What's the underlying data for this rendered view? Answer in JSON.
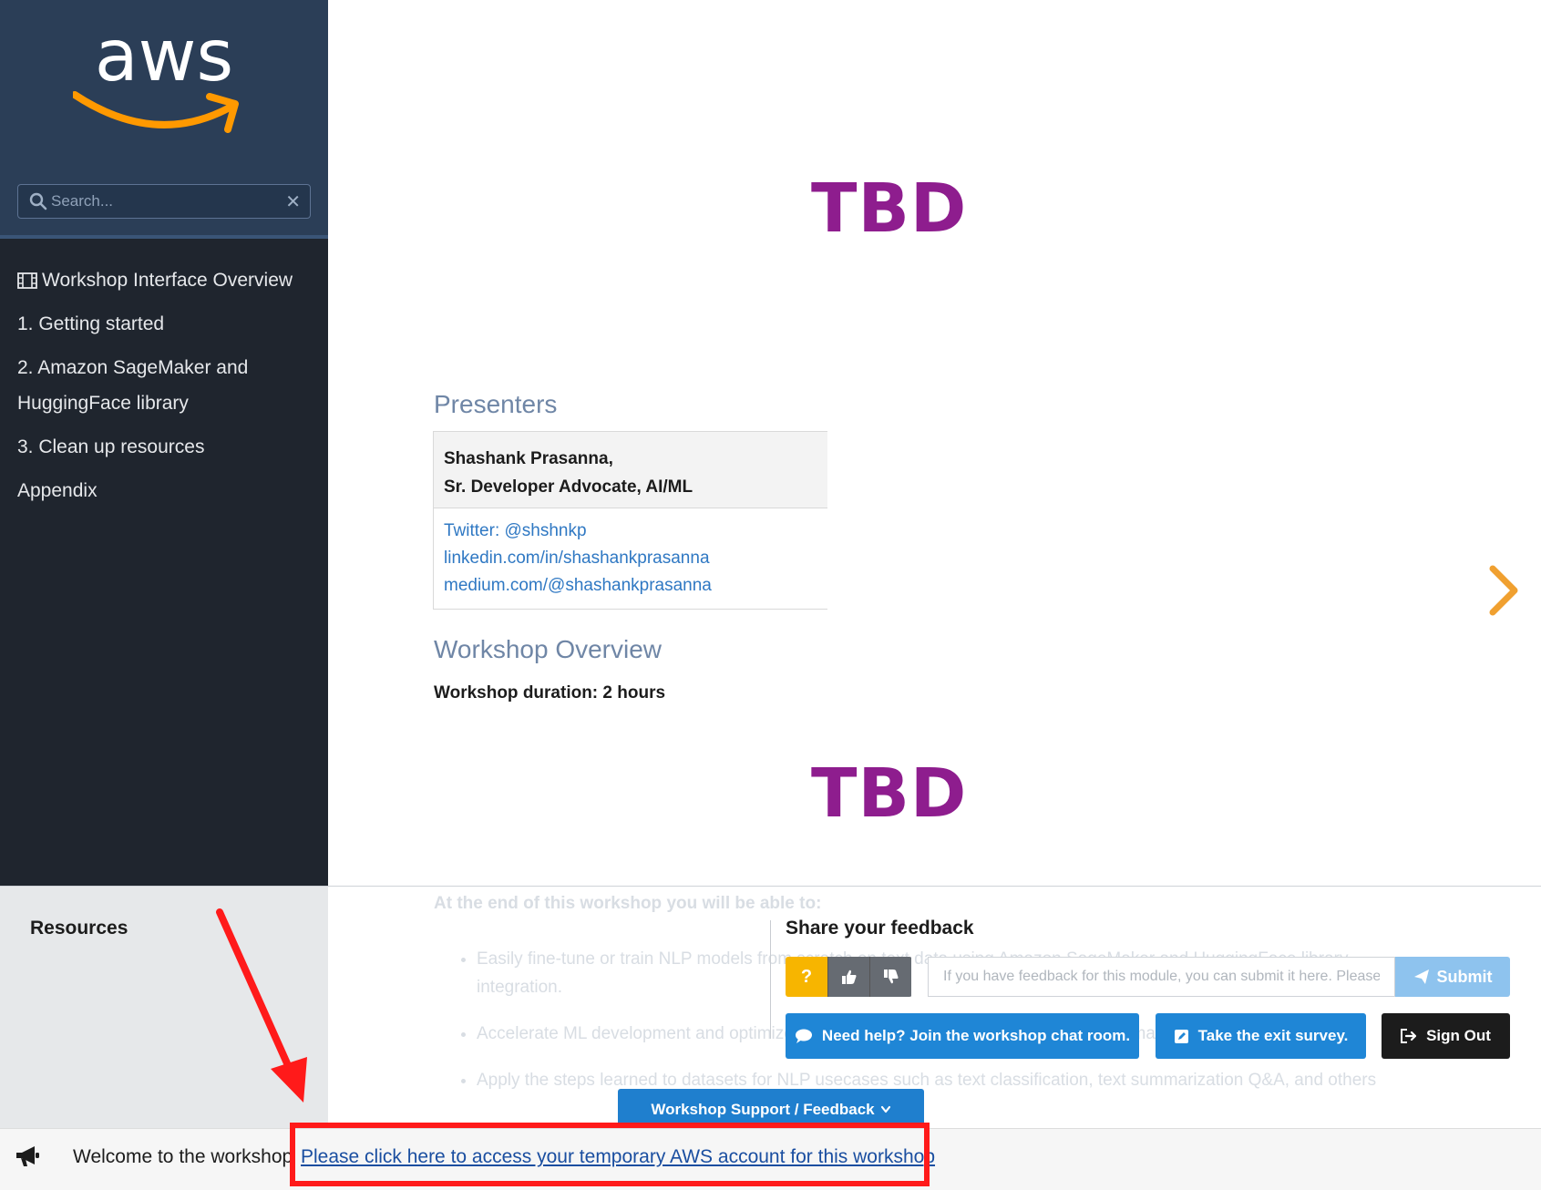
{
  "sidebar": {
    "search": {
      "placeholder": "Search...",
      "clear": "✕"
    },
    "items": [
      {
        "label": "Workshop Interface Overview",
        "icon": "film-icon"
      },
      {
        "label": "1. Getting started"
      },
      {
        "label": "2. Amazon SageMaker and HuggingFace library"
      },
      {
        "label": "3. Clean up resources"
      },
      {
        "label": "Appendix"
      }
    ]
  },
  "logo": {
    "text": "aws",
    "brand_color": "#ff9900"
  },
  "main": {
    "placeholder_image_text": "TBD",
    "presenters_title": "Presenters",
    "presenter": {
      "name_line": "Shashank Prasanna,",
      "title_line": "Sr. Developer Advocate, AI/ML",
      "links": [
        "Twitter: @shshnkp",
        "linkedin.com/in/shashankprasanna",
        "medium.com/@shashankprasanna"
      ]
    },
    "overview_title": "Workshop Overview",
    "duration": "Workshop duration: 2 hours",
    "faded": {
      "heading": "At the end of this workshop you will be able to:",
      "bullets": [
        "Easily fine-tune or train NLP models from scratch on text data using Amazon SageMaker and HuggingFace library integration.",
        "Accelerate ML development and optimize cost using managed training instances and managed spot training",
        "Apply the steps learned to datasets for NLP usecases such as text classification, text summarization Q&A, and others"
      ]
    }
  },
  "bottom": {
    "resources_title": "Resources",
    "feedback_title": "Share your feedback",
    "rating": {
      "question": "?"
    },
    "feedback_placeholder": "If you have feedback for this module, you can submit it here. Please",
    "submit_label": "Submit",
    "chat_label": "Need help? Join the workshop chat room.",
    "survey_label": "Take the exit survey.",
    "signout_label": "Sign Out",
    "support_label": "Workshop Support / Feedback"
  },
  "announce": {
    "welcome": "Welcome to the workshop",
    "link": "Please click here to access your temporary AWS account for this workshop"
  },
  "colors": {
    "sidebar_bg": "#1f252e",
    "sidebar_header_bg": "#2b3e57",
    "tbd_purple": "#8e1d8e",
    "section_title": "#6f86a6",
    "link_blue": "#2f78c3",
    "action_blue": "#1f86d6",
    "annotation_red": "#ff1a1a"
  }
}
